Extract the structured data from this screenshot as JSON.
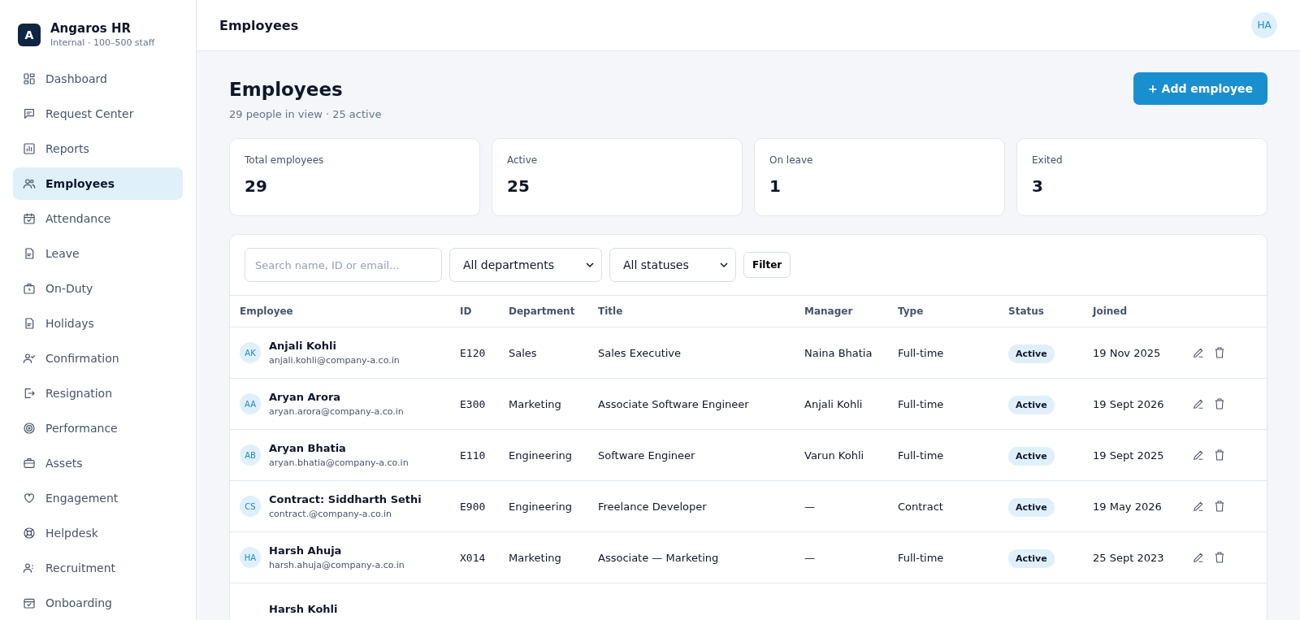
{
  "brand": {
    "logo_letter": "A",
    "name": "Angaros HR",
    "subtitle": "Internal · 100–500 staff"
  },
  "sidebar": {
    "items": [
      {
        "label": "Dashboard",
        "selected": false
      },
      {
        "label": "Request Center",
        "selected": false
      },
      {
        "label": "Reports",
        "selected": false
      },
      {
        "label": "Employees",
        "selected": true
      },
      {
        "label": "Attendance",
        "selected": false
      },
      {
        "label": "Leave",
        "selected": false
      },
      {
        "label": "On-Duty",
        "selected": false
      },
      {
        "label": "Holidays",
        "selected": false
      },
      {
        "label": "Confirmation",
        "selected": false
      },
      {
        "label": "Resignation",
        "selected": false
      },
      {
        "label": "Performance",
        "selected": false
      },
      {
        "label": "Assets",
        "selected": false
      },
      {
        "label": "Engagement",
        "selected": false
      },
      {
        "label": "Helpdesk",
        "selected": false
      },
      {
        "label": "Recruitment",
        "selected": false
      },
      {
        "label": "Onboarding",
        "selected": false
      }
    ]
  },
  "topbar": {
    "title": "Employees",
    "user_initials": "HA"
  },
  "page": {
    "title": "Employees",
    "subtitle": "29 people in view · 25 active",
    "add_button": "+ Add employee"
  },
  "stats": [
    {
      "label": "Total employees",
      "value": "29"
    },
    {
      "label": "Active",
      "value": "25"
    },
    {
      "label": "On leave",
      "value": "1"
    },
    {
      "label": "Exited",
      "value": "3"
    }
  ],
  "filters": {
    "search_placeholder": "Search name, ID or email...",
    "department": "All departments",
    "status": "All statuses",
    "filter_button": "Filter"
  },
  "table": {
    "columns": [
      "Employee",
      "ID",
      "Department",
      "Title",
      "Manager",
      "Type",
      "Status",
      "Joined"
    ],
    "rows": [
      {
        "initials": "AK",
        "name": "Anjali Kohli",
        "email": "anjali.kohli@company-a.co.in",
        "id": "E120",
        "department": "Sales",
        "title": "Sales Executive",
        "manager": "Naina Bhatia",
        "type": "Full-time",
        "status": "Active",
        "joined": "19 Nov 2025"
      },
      {
        "initials": "AA",
        "name": "Aryan Arora",
        "email": "aryan.arora@company-a.co.in",
        "id": "E300",
        "department": "Marketing",
        "title": "Associate Software Engineer",
        "manager": "Anjali Kohli",
        "type": "Full-time",
        "status": "Active",
        "joined": "19 Sept 2026"
      },
      {
        "initials": "AB",
        "name": "Aryan Bhatia",
        "email": "aryan.bhatia@company-a.co.in",
        "id": "E110",
        "department": "Engineering",
        "title": "Software Engineer",
        "manager": "Varun Kohli",
        "type": "Full-time",
        "status": "Active",
        "joined": "19 Sept 2025"
      },
      {
        "initials": "CS",
        "name": "Contract: Siddharth Sethi",
        "email": "contract.@company-a.co.in",
        "id": "E900",
        "department": "Engineering",
        "title": "Freelance Developer",
        "manager": "—",
        "type": "Contract",
        "status": "Active",
        "joined": "19 May 2026"
      },
      {
        "initials": "HA",
        "name": "Harsh Ahuja",
        "email": "harsh.ahuja@company-a.co.in",
        "id": "X014",
        "department": "Marketing",
        "title": "Associate — Marketing",
        "manager": "—",
        "type": "Full-time",
        "status": "Active",
        "joined": "25 Sept 2023"
      },
      {
        "name": "Harsh Kohli"
      }
    ]
  }
}
